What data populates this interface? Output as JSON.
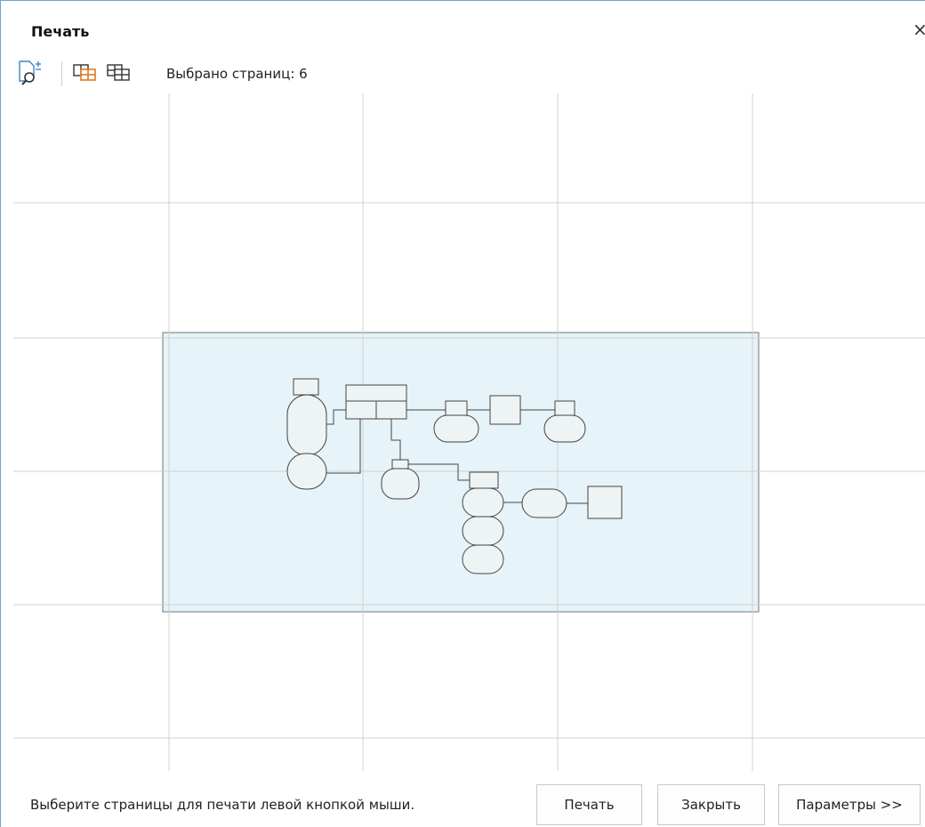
{
  "window": {
    "title": "Печать",
    "close_glyph": "×"
  },
  "toolbar": {
    "buttons": [
      {
        "icon": "zoom-page-icon"
      },
      {
        "icon": "select-pages-icon"
      },
      {
        "icon": "deselect-pages-icon"
      }
    ],
    "selected_count_text": "Выбрано страниц: 6"
  },
  "preview": {
    "page_grid": {
      "columns": 5,
      "rows": 6
    },
    "selected_pages": 6,
    "diagram_fill": "#e6f3f8",
    "grid_color": "#d0d0d0",
    "frame_color": "#8a8a8a"
  },
  "footer": {
    "hint": "Выберите страницы для печати левой кнопкой мыши.",
    "print_label": "Печать",
    "close_label": "Закрыть",
    "params_label": "Параметры >>"
  },
  "colors": {
    "accent": "#3a86c8",
    "icon_orange": "#e07a1e"
  }
}
